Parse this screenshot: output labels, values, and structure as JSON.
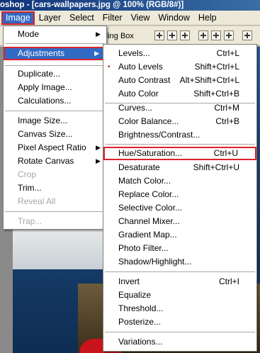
{
  "window": {
    "title": "oshop - [cars-wallpapers.jpg @ 100% (RGB/8#)]"
  },
  "menubar": {
    "items": [
      "Image",
      "Layer",
      "Select",
      "Filter",
      "View",
      "Window",
      "Help"
    ]
  },
  "options_bar": {
    "partial_text": "nding Box"
  },
  "image_menu": {
    "items": [
      {
        "label": "Mode",
        "arrow": "▶"
      },
      {
        "label": "Adjustments",
        "arrow": "▶"
      },
      {
        "label": "Duplicate..."
      },
      {
        "label": "Apply Image..."
      },
      {
        "label": "Calculations..."
      },
      {
        "label": "Image Size..."
      },
      {
        "label": "Canvas Size..."
      },
      {
        "label": "Pixel Aspect Ratio",
        "arrow": "▶"
      },
      {
        "label": "Rotate Canvas",
        "arrow": "▶"
      },
      {
        "label": "Crop"
      },
      {
        "label": "Trim..."
      },
      {
        "label": "Reveal All"
      },
      {
        "label": "Trap..."
      }
    ]
  },
  "adjustments_menu": {
    "items": [
      {
        "label": "Levels...",
        "shortcut": "Ctrl+L"
      },
      {
        "label": "Auto Levels",
        "shortcut": "Shift+Ctrl+L",
        "bullet": "•"
      },
      {
        "label": "Auto Contrast",
        "shortcut": "Alt+Shift+Ctrl+L"
      },
      {
        "label": "Auto Color",
        "shortcut": "Shift+Ctrl+B"
      },
      {
        "label": "Curves...",
        "shortcut": "Ctrl+M"
      },
      {
        "label": "Color Balance...",
        "shortcut": "Ctrl+B"
      },
      {
        "label": "Brightness/Contrast..."
      },
      {
        "label": "Hue/Saturation...",
        "shortcut": "Ctrl+U"
      },
      {
        "label": "Desaturate",
        "shortcut": "Shift+Ctrl+U"
      },
      {
        "label": "Match Color..."
      },
      {
        "label": "Replace Color..."
      },
      {
        "label": "Selective Color..."
      },
      {
        "label": "Channel Mixer..."
      },
      {
        "label": "Gradient Map..."
      },
      {
        "label": "Photo Filter..."
      },
      {
        "label": "Shadow/Highlight..."
      },
      {
        "label": "Invert",
        "shortcut": "Ctrl+I"
      },
      {
        "label": "Equalize"
      },
      {
        "label": "Threshold..."
      },
      {
        "label": "Posterize..."
      },
      {
        "label": "Variations..."
      }
    ]
  },
  "colors": {
    "highlight": "#316ac5",
    "annotation_frame": "#d8232a"
  }
}
